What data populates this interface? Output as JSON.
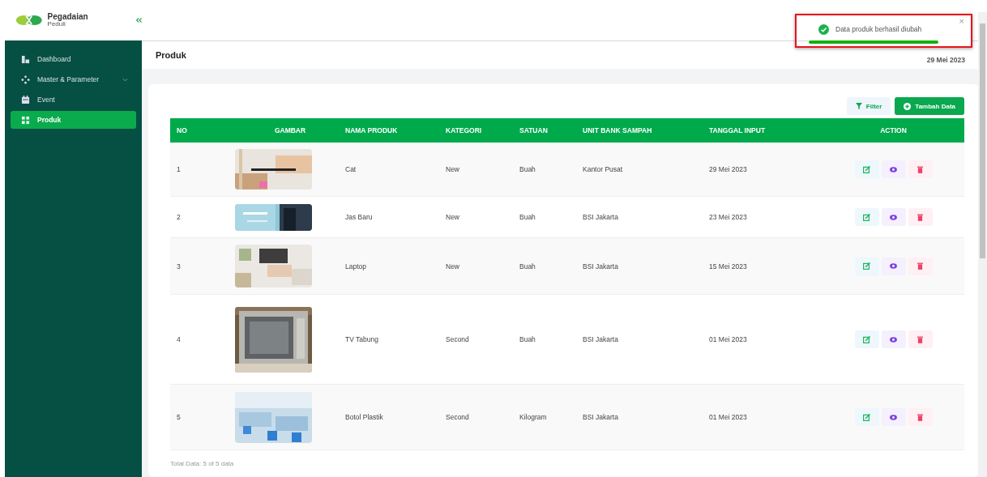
{
  "logo": {
    "name": "Pegadaian",
    "tagline": "Peduli"
  },
  "sidebar": {
    "items": [
      {
        "label": "Dashboard",
        "kind": "chart",
        "selected": false
      },
      {
        "label": "Master & Parameter",
        "kind": "nodes",
        "selected": false,
        "expandable": true
      },
      {
        "label": "Event",
        "kind": "calendar",
        "selected": false
      },
      {
        "label": "Produk",
        "kind": "grid",
        "selected": true
      }
    ]
  },
  "page": {
    "title": "Produk",
    "date": "29 Mei 2023"
  },
  "toolbar": {
    "filter": "Filter",
    "add": "Tambah Data"
  },
  "table": {
    "columns": [
      "NO",
      "GAMBAR",
      "NAMA PRODUK",
      "KATEGORI",
      "SATUAN",
      "UNIT BANK SAMPAH",
      "TANGGAL INPUT",
      "ACTION"
    ],
    "rows": [
      {
        "no": "1",
        "name": "Cat",
        "category": "New",
        "unit": "Buah",
        "bank": "Kantor Pusat",
        "date": "29 Mei 2023"
      },
      {
        "no": "2",
        "name": "Jas Baru",
        "category": "New",
        "unit": "Buah",
        "bank": "BSI Jakarta",
        "date": "23 Mei 2023"
      },
      {
        "no": "3",
        "name": "Laptop",
        "category": "New",
        "unit": "Buah",
        "bank": "BSI Jakarta",
        "date": "15 Mei 2023"
      },
      {
        "no": "4",
        "name": "TV Tabung",
        "category": "Second",
        "unit": "Buah",
        "bank": "BSI Jakarta",
        "date": "01 Mei 2023"
      },
      {
        "no": "5",
        "name": "Botol Plastik",
        "category": "Second",
        "unit": "Kilogram",
        "bank": "BSI Jakarta",
        "date": "01 Mei 2023"
      }
    ]
  },
  "total": "Total Data: 5 of 5 data",
  "toast": {
    "message": "Data produk berhasil diubah",
    "close": "×",
    "level": 0.8,
    "highlighted": true
  }
}
